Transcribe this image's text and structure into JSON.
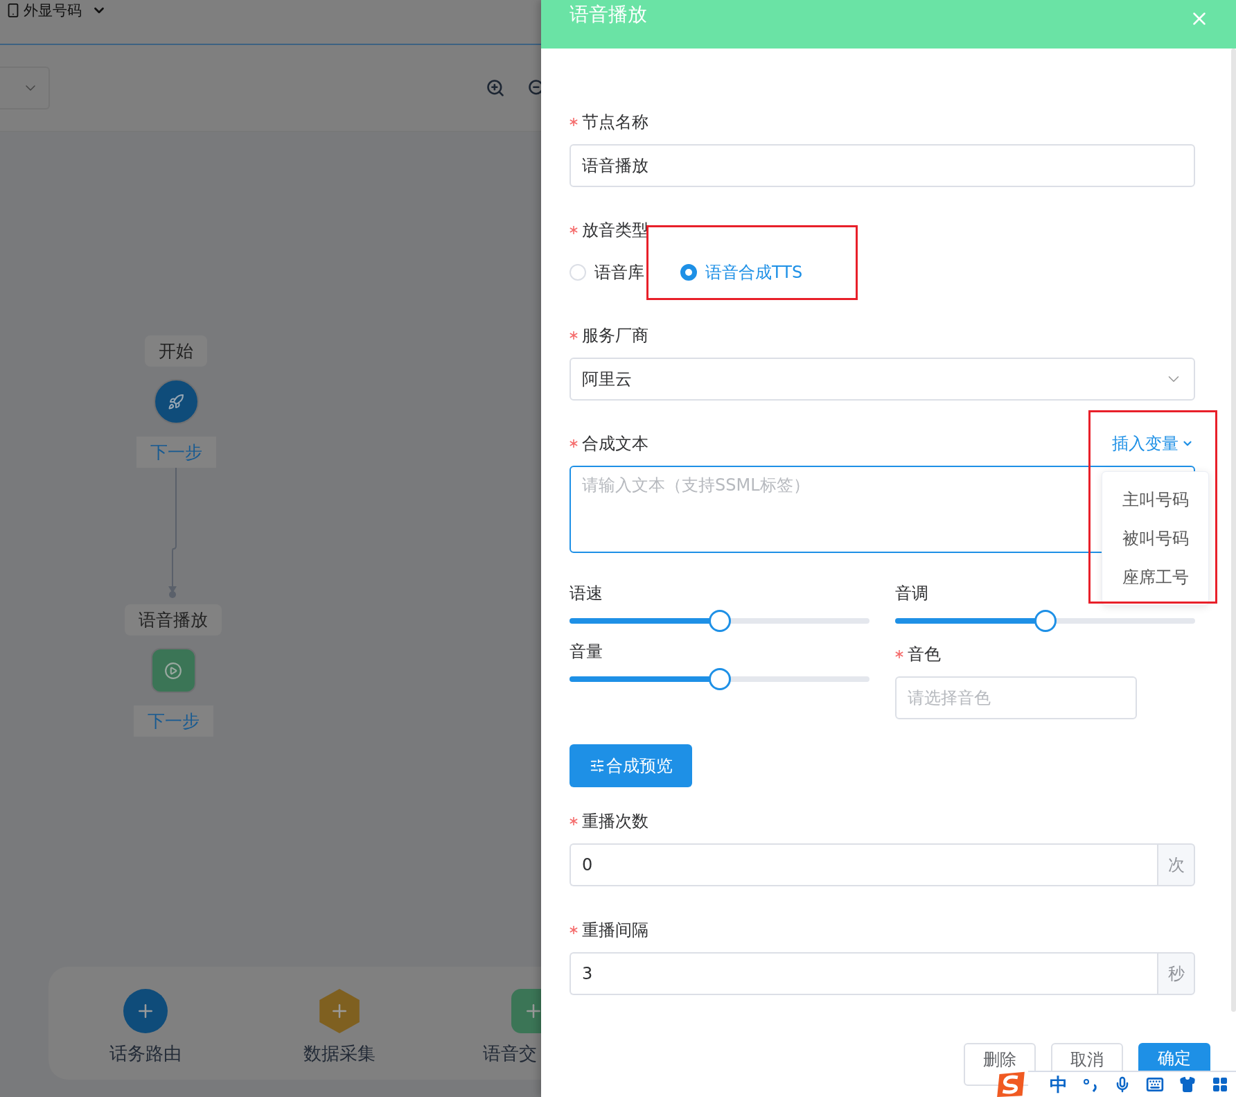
{
  "page": {
    "caller_id_label": "外显号码"
  },
  "canvas": {
    "nodes": [
      {
        "kind": "start",
        "label": "开始",
        "next": "下一步"
      },
      {
        "kind": "play",
        "label": "语音播放",
        "next": "下一步"
      }
    ]
  },
  "palette": [
    {
      "kind": "circle",
      "color": "#0f4c7a",
      "label": "话务路由"
    },
    {
      "kind": "hexagon",
      "color": "#7f6020",
      "label": "数据采集"
    },
    {
      "kind": "square",
      "color": "#3b7556",
      "label": "语音交"
    }
  ],
  "drawer": {
    "title": "语音播放",
    "node_name": {
      "label": "节点名称",
      "required": true,
      "value": "语音播放"
    },
    "play_type": {
      "label": "放音类型",
      "required": true,
      "options": [
        {
          "label": "语音库",
          "selected": false
        },
        {
          "label": "语音合成TTS",
          "selected": true
        }
      ]
    },
    "vendor": {
      "label": "服务厂商",
      "required": true,
      "value": "阿里云"
    },
    "text": {
      "label": "合成文本",
      "required": true,
      "insert_link": "插入变量",
      "placeholder": "请输入文本（支持SSML标签）",
      "menu": [
        "主叫号码",
        "被叫号码",
        "座席工号"
      ]
    },
    "speed": {
      "label": "语速",
      "level": 0.5
    },
    "pitch": {
      "label": "音调",
      "level": 0.5
    },
    "volume": {
      "label": "音量",
      "level": 0.5
    },
    "timbre": {
      "label": "音色",
      "required": true,
      "placeholder": "请选择音色"
    },
    "preview_button": "合成预览",
    "repeat_count": {
      "label": "重播次数",
      "required": true,
      "value": "0",
      "unit": "次"
    },
    "repeat_interval": {
      "label": "重播间隔",
      "required": true,
      "value": "3",
      "unit": "秒"
    },
    "footer_buttons": [
      {
        "label": "删除",
        "kind": "default"
      },
      {
        "label": "取消",
        "kind": "default"
      },
      {
        "label": "确定",
        "kind": "primary"
      }
    ]
  },
  "ime": {
    "mode": "中"
  }
}
